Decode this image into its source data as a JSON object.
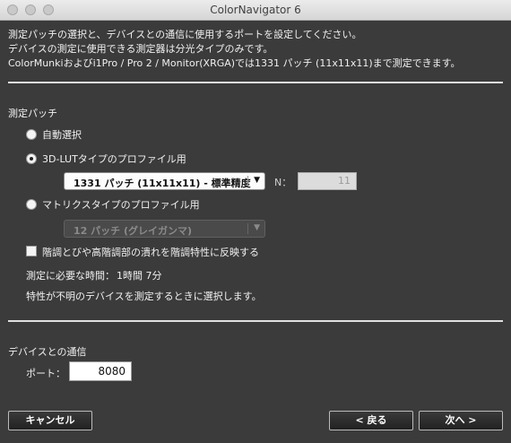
{
  "window": {
    "title": "ColorNavigator 6"
  },
  "intro": {
    "line1": "測定パッチの選択と、デバイスとの通信に使用するポートを設定してください。",
    "line2": "デバイスの測定に使用できる測定器は分光タイプのみです。",
    "line3": "ColorMunkiおよびi1Pro / Pro 2 / Monitor(XRGA)では1331 パッチ (11x11x11)まで測定できます。"
  },
  "patch_section": {
    "title": "測定パッチ",
    "options": [
      {
        "label": "自動選択",
        "checked": false
      },
      {
        "label": "3D-LUTタイプのプロファイル用",
        "checked": true
      },
      {
        "label": "マトリクスタイプのプロファイル用",
        "checked": false
      }
    ],
    "lut_select": "1331 パッチ (11x11x11) - 標準精度",
    "n_label": "N：",
    "n_value": "11",
    "matrix_select": "12 パッチ (グレイガンマ)",
    "reflect_checkbox": {
      "label": "階調とびや高階調部の潰れを階調特性に反映する",
      "checked": false
    },
    "time_label": "測定に必要な時間：",
    "time_value": "1時間 7分",
    "note": "特性が不明のデバイスを測定するときに選択します。"
  },
  "comm_section": {
    "title": "デバイスとの通信",
    "port_label": "ポート：",
    "port_value": "8080"
  },
  "buttons": {
    "cancel": "キャンセル",
    "back": "< 戻る",
    "next": "次へ >"
  },
  "icons": {
    "dropdown": "chevron-down-icon",
    "selected_radio": "radio-dot-icon"
  }
}
